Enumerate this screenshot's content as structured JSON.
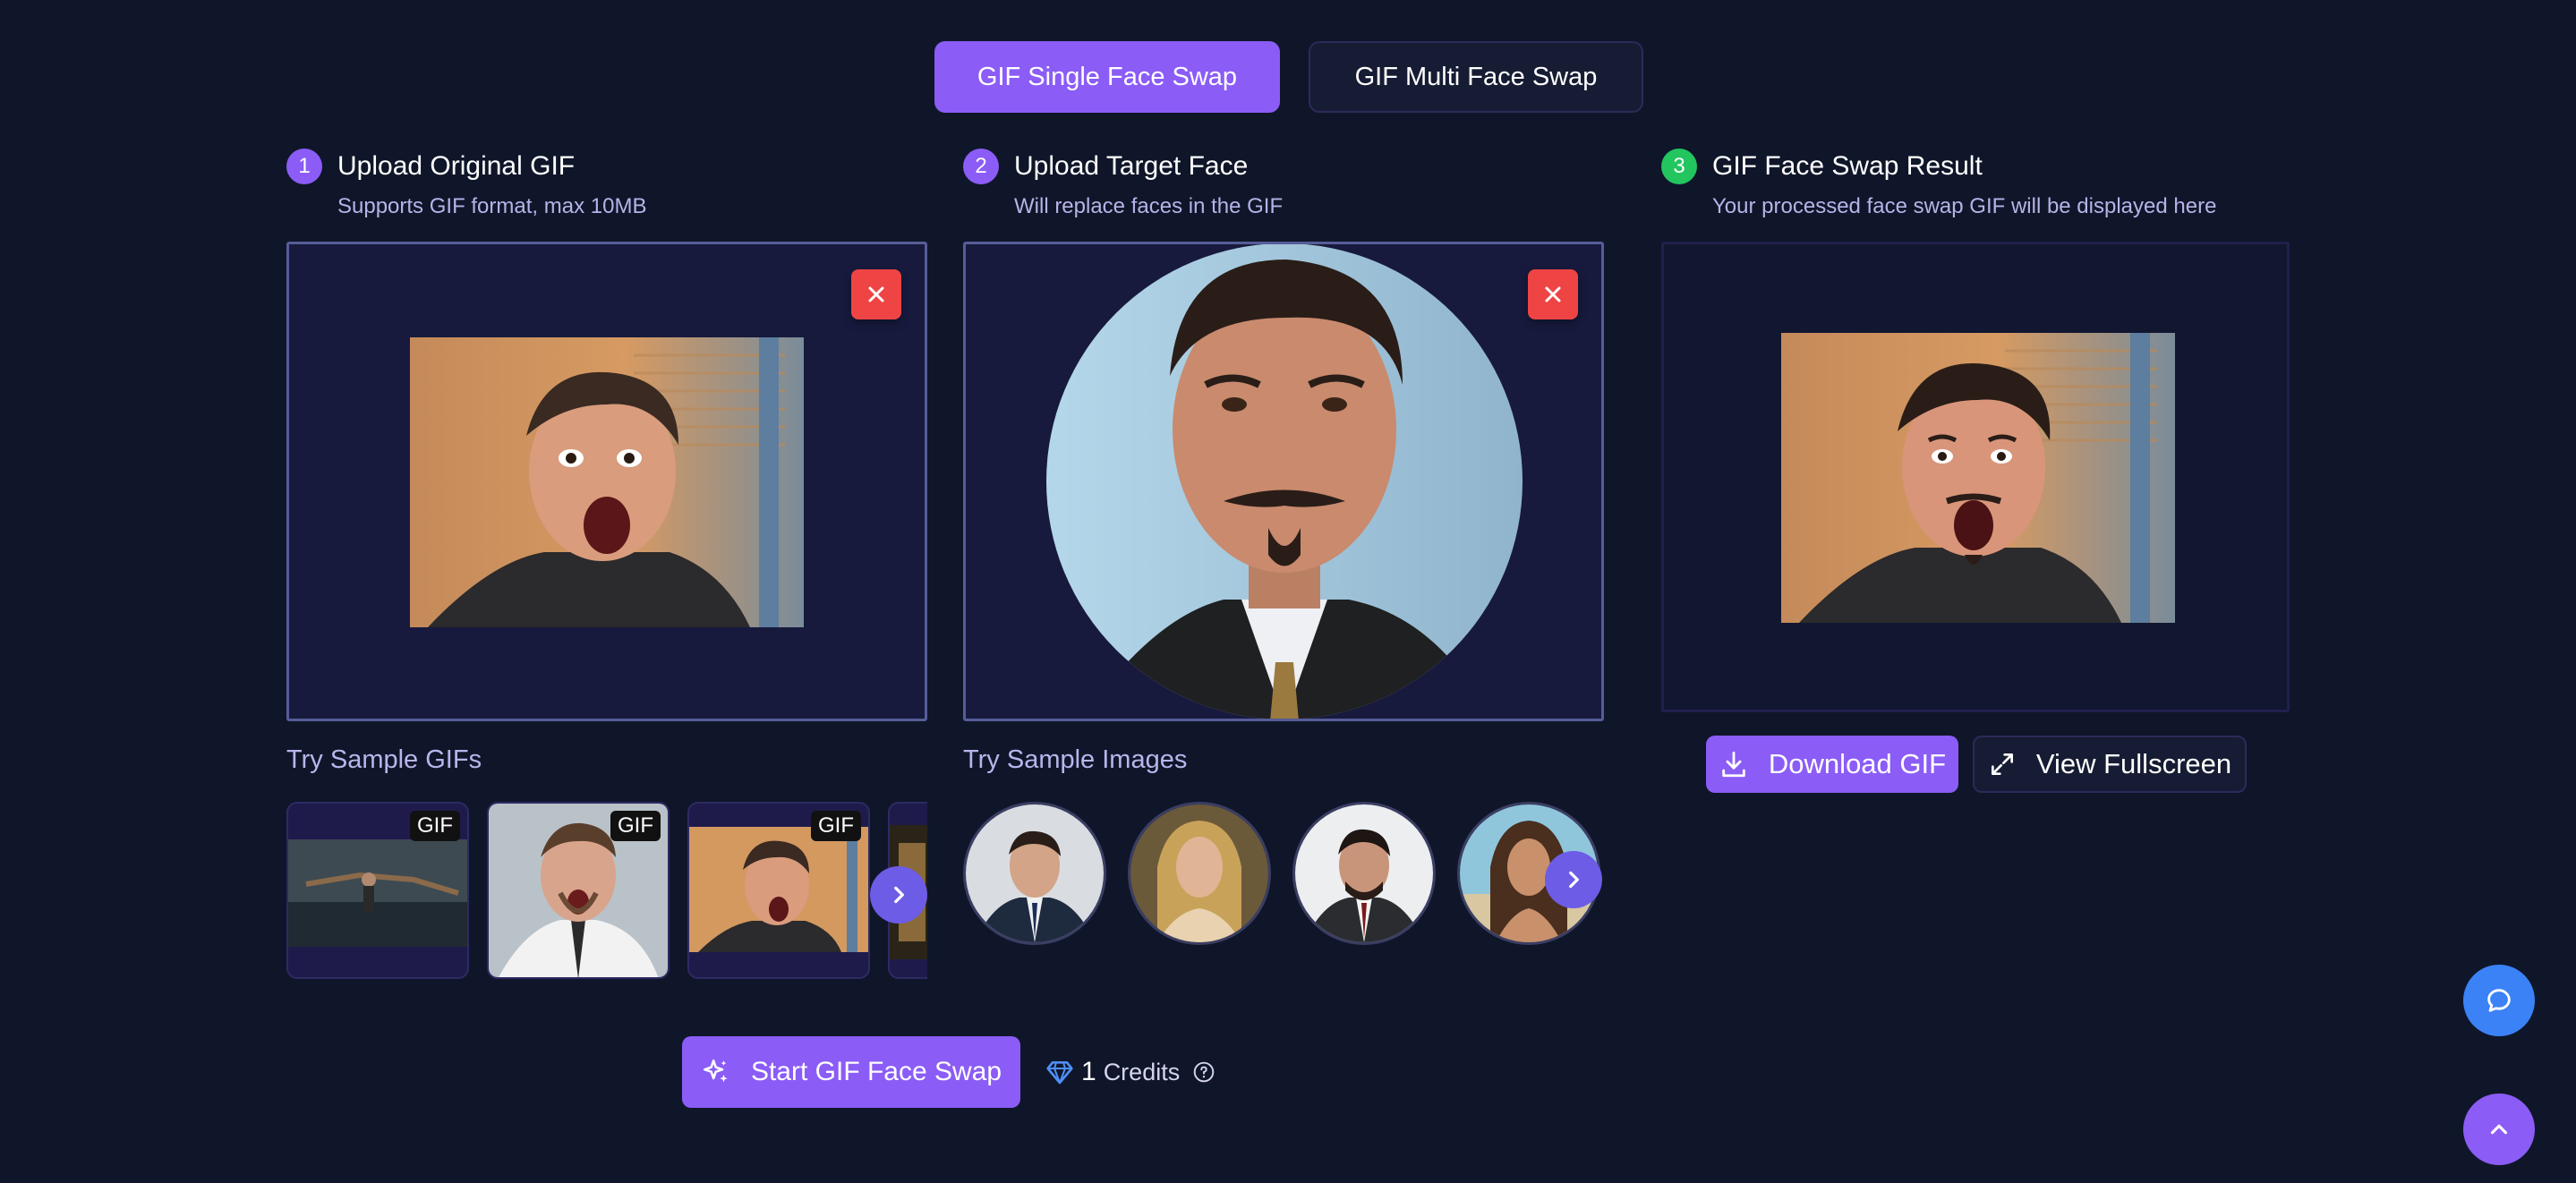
{
  "tabs": {
    "single": "GIF Single Face Swap",
    "multi": "GIF Multi Face Swap"
  },
  "steps": [
    {
      "num": "1",
      "title": "Upload Original GIF",
      "subtitle": "Supports GIF format, max 10MB"
    },
    {
      "num": "2",
      "title": "Upload Target Face",
      "subtitle": "Will replace faces in the GIF"
    },
    {
      "num": "3",
      "title": "GIF Face Swap Result",
      "subtitle": "Your processed face swap GIF will be displayed here"
    }
  ],
  "samples": {
    "gifs_title": "Try Sample GIFs",
    "images_title": "Try Sample Images",
    "gif_badge": "GIF"
  },
  "result_actions": {
    "download": "Download GIF",
    "fullscreen": "View Fullscreen"
  },
  "start": {
    "label": "Start GIF Face Swap",
    "credits_count": "1",
    "credits_label": "Credits"
  },
  "colors": {
    "background": "#0f1629",
    "accent": "#8b5cf6",
    "remove": "#ef4444",
    "success": "#22c55e",
    "chat": "#3b82f6"
  },
  "icons": [
    "close-icon",
    "chevron-right-icon",
    "sparkles-icon",
    "diamond-icon",
    "help-circle-icon",
    "download-icon",
    "expand-icon",
    "chat-icon",
    "chevron-up-icon"
  ]
}
